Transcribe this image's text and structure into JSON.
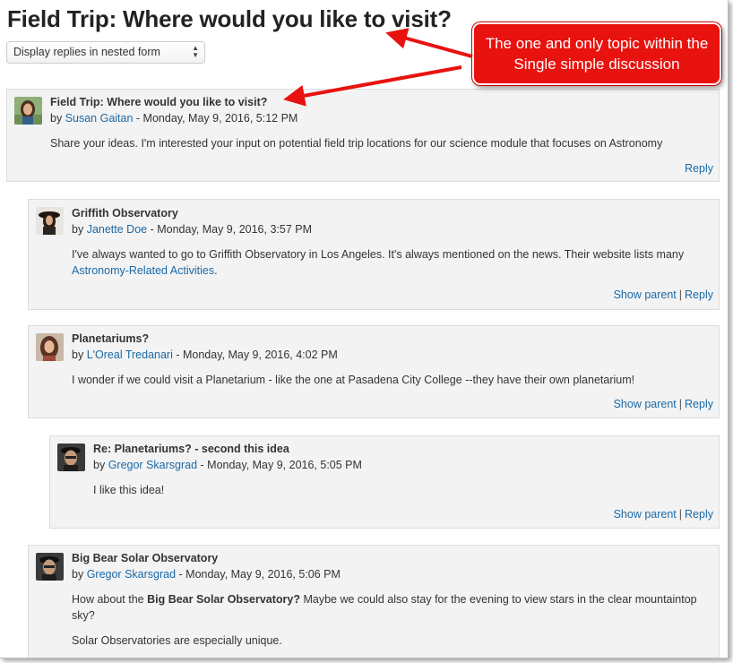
{
  "page": {
    "title": "Field Trip: Where would you like to visit?",
    "display_mode": "Display replies in nested form"
  },
  "callout": {
    "line1": "The one and only topic within the",
    "line2": "Single simple discussion"
  },
  "posts": [
    {
      "subject": "Field Trip: Where would you like to visit?",
      "by": "by",
      "author": "Susan Gaitan",
      "date": " - Monday, May 9, 2016, 5:12 PM",
      "content": "Share your ideas.  I'm interested your input on potential field trip locations for our science module that focuses on Astronomy",
      "reply": "Reply"
    },
    {
      "subject": "Griffith Observatory",
      "by": "by",
      "author": "Janette Doe",
      "date": " - Monday, May 9, 2016, 3:57 PM",
      "content": "I've always wanted to go to Griffith Observatory in Los Angeles.  It's always mentioned on the news.  Their website lists many",
      "link": "Astronomy-Related Activities",
      "link_suffix": ".",
      "show_parent": "Show parent",
      "separator": "|",
      "reply": "Reply"
    },
    {
      "subject": "Planetariums?",
      "by": "by",
      "author": "L'Oreal Tredanari",
      "date": " - Monday, May 9, 2016, 4:02 PM",
      "content": "I wonder if we could visit a Planetarium - like the one at Pasadena City College --they have their own planetarium!",
      "show_parent": "Show parent",
      "separator": "|",
      "reply": "Reply"
    },
    {
      "subject": "Re: Planetariums? - second this idea",
      "by": "by",
      "author": "Gregor Skarsgrad",
      "date": " - Monday, May 9, 2016, 5:05 PM",
      "content": "I like this idea!",
      "show_parent": "Show parent",
      "separator": "|",
      "reply": "Reply"
    },
    {
      "subject": "Big Bear Solar Observatory",
      "by": "by",
      "author": "Gregor Skarsgrad",
      "date": " - Monday, May 9, 2016, 5:06 PM",
      "content_pre": "How about the ",
      "content_bold": "Big Bear Solar Observatory?",
      "content_post": " Maybe we could also stay for the evening to view stars in the clear mountaintop sky?",
      "content2": "Solar Observatories are especially unique."
    }
  ],
  "colors": {
    "link": "#1a6aa8",
    "callout_bg": "#e8120f",
    "post_bg": "#f3f3f3"
  }
}
